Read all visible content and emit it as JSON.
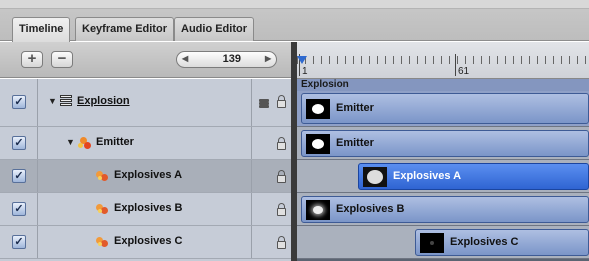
{
  "tabs": [
    {
      "label": "Timeline",
      "active": true
    },
    {
      "label": "Keyframe Editor",
      "active": false
    },
    {
      "label": "Audio Editor",
      "active": false
    }
  ],
  "controls": {
    "add_label": "+",
    "remove_label": "−",
    "frame_value": "139",
    "prev_arrow": "◀",
    "next_arrow": "▶"
  },
  "ruler": {
    "start_label": "1",
    "mid_label": "61"
  },
  "layers": [
    {
      "name": "Explosion",
      "checked": true,
      "check_glyph": "✓",
      "type": "group"
    },
    {
      "name": "Emitter",
      "checked": true,
      "check_glyph": "✓",
      "type": "emitter"
    },
    {
      "name": "Explosives A",
      "checked": true,
      "check_glyph": "✓",
      "type": "cell",
      "selected": true
    },
    {
      "name": "Explosives B",
      "checked": true,
      "check_glyph": "✓",
      "type": "cell"
    },
    {
      "name": "Explosives C",
      "checked": true,
      "check_glyph": "✓",
      "type": "cell"
    }
  ],
  "timeline": {
    "group_label": "Explosion",
    "bars": [
      {
        "label": "Emitter"
      },
      {
        "label": "Emitter"
      },
      {
        "label": "Explosives A",
        "selected": true
      },
      {
        "label": "Explosives B"
      },
      {
        "label": "Explosives C"
      }
    ]
  },
  "colors": {
    "selection": "#2f64d2",
    "bar": "#7b95c8",
    "row": "#c6ccd7"
  }
}
